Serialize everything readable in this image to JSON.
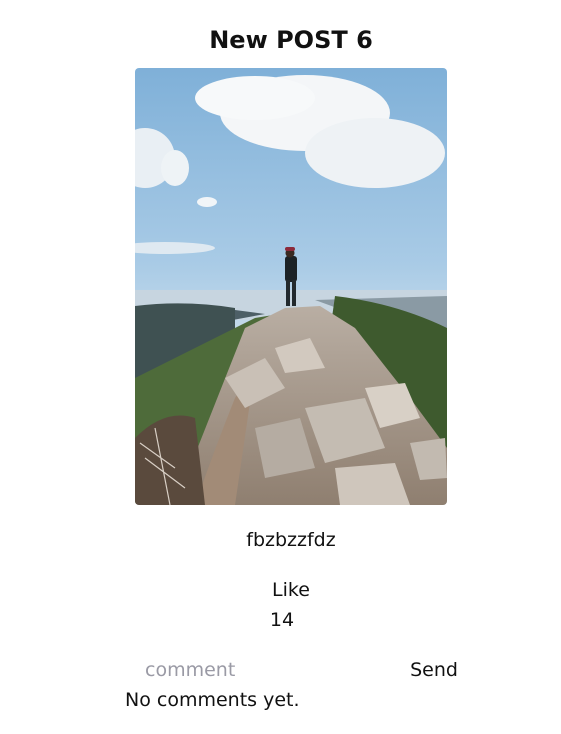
{
  "post": {
    "title": "New POST 6",
    "image_alt": "person standing on rocky mountain ridge under blue sky",
    "caption": "fbzbzzfdz",
    "like_label": "Like",
    "like_count": "14"
  },
  "comments": {
    "input_placeholder": "comment",
    "input_value": "",
    "send_label": "Send",
    "empty_text": "No comments yet."
  }
}
